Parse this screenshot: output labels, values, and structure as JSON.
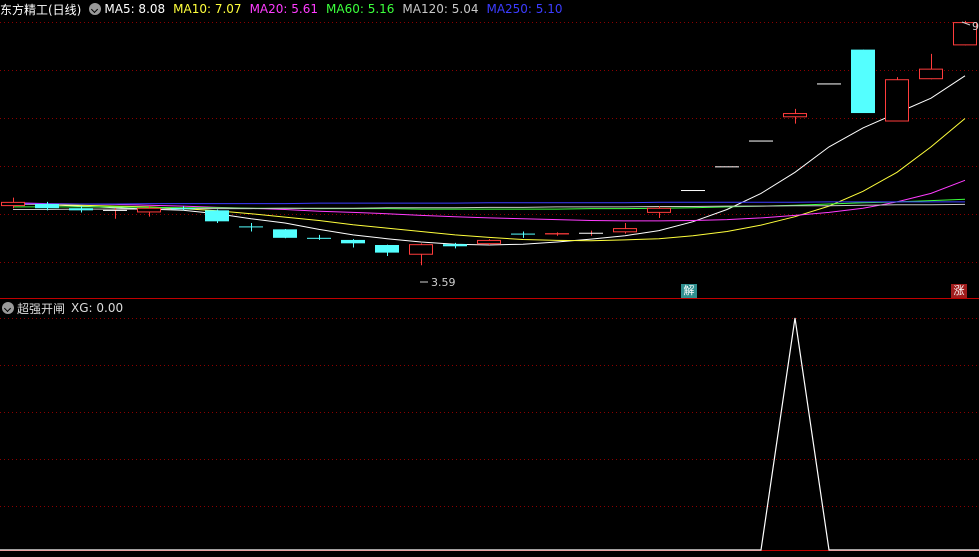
{
  "main_panel": {
    "title": "东方精工(日线)",
    "ma": [
      {
        "label": "MA5: 8.08",
        "color": "#ffffff"
      },
      {
        "label": "MA10: 7.07",
        "color": "#ffff3c"
      },
      {
        "label": "MA20: 5.61",
        "color": "#ff3cff"
      },
      {
        "label": "MA60: 5.16",
        "color": "#3cff3c"
      },
      {
        "label": "MA120: 5.04",
        "color": "#c8c8c8"
      },
      {
        "label": "MA250: 5.10",
        "color": "#3c3cff"
      }
    ],
    "low_label": "3.59",
    "high_label": "9",
    "badge_jie": "解",
    "badge_zhang": "涨"
  },
  "indicator_panel": {
    "title": "超强开闸",
    "xg_label": "XG: 0.00"
  },
  "colors": {
    "up": "#ff3c3c",
    "down": "#54ffff",
    "grid": "#8b0000",
    "divider": "#c00000"
  },
  "chart_data": [
    {
      "type": "candlestick",
      "title": "东方精工(日线)",
      "ylim": [
        3.3,
        9.4
      ],
      "annotations": [
        "3.59",
        "9"
      ],
      "candles": [
        {
          "o": 5.0,
          "c": 5.1,
          "h": 5.2,
          "l": 4.95
        },
        {
          "o": 5.05,
          "c": 4.95,
          "h": 5.1,
          "l": 4.9
        },
        {
          "o": 4.95,
          "c": 4.9,
          "h": 5.0,
          "l": 4.85
        },
        {
          "o": 4.9,
          "c": 4.91,
          "h": 4.95,
          "l": 4.7
        },
        {
          "o": 4.85,
          "c": 4.96,
          "h": 5.0,
          "l": 4.75
        },
        {
          "o": 4.95,
          "c": 4.94,
          "h": 5.0,
          "l": 4.9
        },
        {
          "o": 4.9,
          "c": 4.64,
          "h": 4.92,
          "l": 4.6
        },
        {
          "o": 4.52,
          "c": 4.5,
          "h": 4.6,
          "l": 4.4
        },
        {
          "o": 4.45,
          "c": 4.25,
          "h": 4.46,
          "l": 4.24
        },
        {
          "o": 4.25,
          "c": 4.23,
          "h": 4.32,
          "l": 4.2
        },
        {
          "o": 4.2,
          "c": 4.12,
          "h": 4.22,
          "l": 4.02
        },
        {
          "o": 4.08,
          "c": 3.9,
          "h": 4.09,
          "l": 3.82
        },
        {
          "o": 3.85,
          "c": 4.1,
          "h": 4.12,
          "l": 3.6
        },
        {
          "o": 4.1,
          "c": 4.05,
          "h": 4.13,
          "l": 4.0
        },
        {
          "o": 4.1,
          "c": 4.2,
          "h": 4.22,
          "l": 4.08
        },
        {
          "o": 4.35,
          "c": 4.33,
          "h": 4.4,
          "l": 4.25
        },
        {
          "o": 4.33,
          "c": 4.36,
          "h": 4.38,
          "l": 4.3
        },
        {
          "o": 4.35,
          "c": 4.37,
          "h": 4.42,
          "l": 4.3
        },
        {
          "o": 4.38,
          "c": 4.48,
          "h": 4.6,
          "l": 4.35
        },
        {
          "o": 4.84,
          "c": 4.96,
          "h": 5.0,
          "l": 4.72
        },
        {
          "o": 5.38,
          "c": 5.38,
          "h": 5.38,
          "l": 5.38
        },
        {
          "o": 5.94,
          "c": 5.94,
          "h": 5.94,
          "l": 5.94
        },
        {
          "o": 6.55,
          "c": 6.55,
          "h": 6.55,
          "l": 6.55
        },
        {
          "o": 7.1,
          "c": 7.2,
          "h": 7.3,
          "l": 6.95
        },
        {
          "o": 7.9,
          "c": 7.9,
          "h": 7.9,
          "l": 7.9
        },
        {
          "o": 8.7,
          "c": 7.2,
          "h": 8.7,
          "l": 7.2
        },
        {
          "o": 7.0,
          "c": 8.0,
          "h": 8.05,
          "l": 7.0
        },
        {
          "o": 8.0,
          "c": 8.25,
          "h": 8.6,
          "l": 8.0
        },
        {
          "o": 8.8,
          "c": 9.35,
          "h": 9.38,
          "l": 8.8
        }
      ],
      "series": [
        {
          "name": "MA5",
          "color": "#ffffff",
          "values": [
            5.05,
            5.03,
            5.0,
            4.96,
            4.93,
            4.9,
            4.82,
            4.7,
            4.6,
            4.45,
            4.32,
            4.23,
            4.15,
            4.1,
            4.08,
            4.1,
            4.15,
            4.22,
            4.3,
            4.42,
            4.63,
            4.92,
            5.3,
            5.8,
            6.4,
            6.85,
            7.2,
            7.55,
            8.08
          ]
        },
        {
          "name": "MA10",
          "color": "#ffff3c",
          "values": [
            5.05,
            5.03,
            5.02,
            5.0,
            4.98,
            4.94,
            4.89,
            4.82,
            4.74,
            4.66,
            4.56,
            4.48,
            4.4,
            4.32,
            4.26,
            4.21,
            4.19,
            4.18,
            4.2,
            4.23,
            4.3,
            4.4,
            4.55,
            4.75,
            5.0,
            5.35,
            5.8,
            6.4,
            7.07
          ]
        },
        {
          "name": "MA20",
          "color": "#ff3cff",
          "values": [
            5.08,
            5.06,
            5.05,
            5.04,
            5.02,
            5.0,
            4.97,
            4.95,
            4.92,
            4.88,
            4.85,
            4.82,
            4.78,
            4.75,
            4.72,
            4.7,
            4.68,
            4.66,
            4.65,
            4.65,
            4.66,
            4.68,
            4.72,
            4.78,
            4.85,
            4.95,
            5.1,
            5.3,
            5.61
          ]
        },
        {
          "name": "MA60",
          "color": "#3cff3c",
          "values": [
            4.98,
            4.98,
            4.98,
            4.98,
            4.97,
            4.96,
            4.96,
            4.95,
            4.95,
            4.94,
            4.94,
            4.94,
            4.93,
            4.93,
            4.93,
            4.93,
            4.93,
            4.94,
            4.94,
            4.95,
            4.96,
            4.98,
            5.0,
            5.02,
            5.05,
            5.08,
            5.1,
            5.13,
            5.16
          ]
        },
        {
          "name": "MA120",
          "color": "#c8c8c8",
          "values": [
            4.92,
            4.92,
            4.93,
            4.93,
            4.93,
            4.94,
            4.94,
            4.94,
            4.95,
            4.95,
            4.95,
            4.96,
            4.96,
            4.96,
            4.97,
            4.97,
            4.98,
            4.98,
            4.98,
            4.99,
            4.99,
            5.0,
            5.0,
            5.01,
            5.01,
            5.02,
            5.03,
            5.03,
            5.04
          ]
        },
        {
          "name": "MA250",
          "color": "#3c3cff",
          "values": [
            5.05,
            5.05,
            5.05,
            5.05,
            5.06,
            5.06,
            5.06,
            5.06,
            5.06,
            5.07,
            5.07,
            5.07,
            5.07,
            5.07,
            5.08,
            5.08,
            5.08,
            5.08,
            5.08,
            5.09,
            5.09,
            5.09,
            5.09,
            5.09,
            5.1,
            5.1,
            5.1,
            5.1,
            5.1
          ]
        }
      ]
    },
    {
      "type": "line",
      "title": "超强开闸",
      "ylim": [
        0,
        1
      ],
      "series": [
        {
          "name": "XG",
          "color": "#ffffff",
          "values": [
            0,
            0,
            0,
            0,
            0,
            0,
            0,
            0,
            0,
            0,
            0,
            0,
            0,
            0,
            0,
            0,
            0,
            0,
            0,
            0,
            0,
            0,
            0,
            1,
            0,
            0,
            0,
            0,
            0
          ]
        }
      ]
    }
  ]
}
